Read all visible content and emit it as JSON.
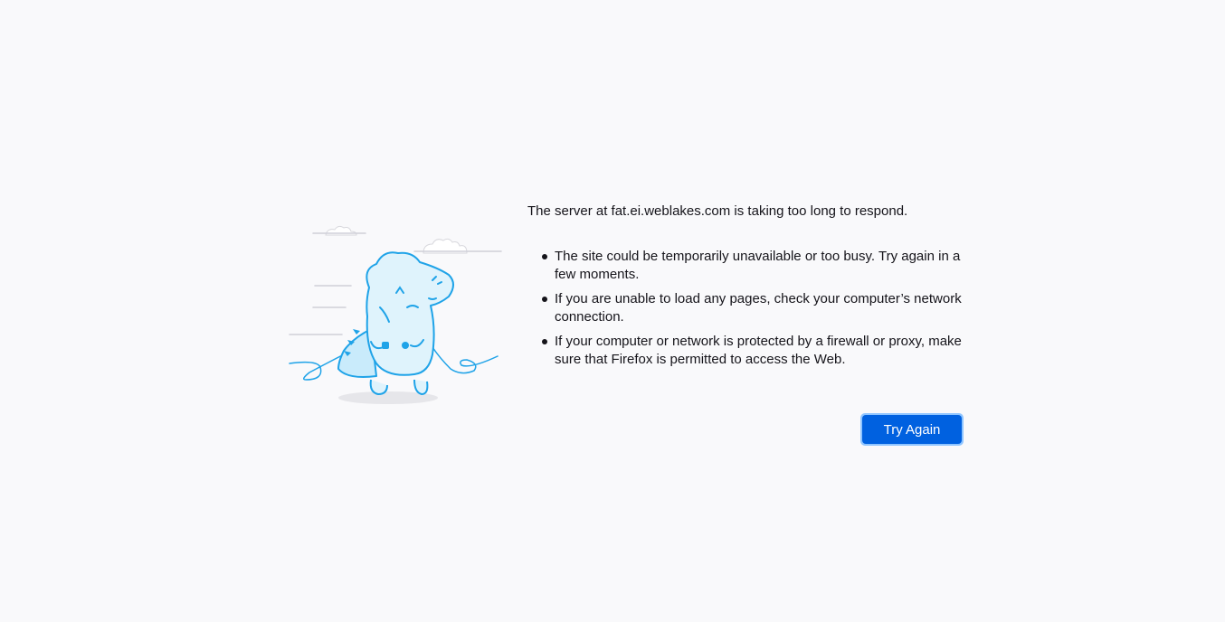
{
  "error": {
    "title": "The server at fat.ei.weblakes.com is taking too long to respond.",
    "reasons": [
      "The site could be temporarily unavailable or too busy. Try again in a few moments.",
      "If you are unable to load any pages, check your computer’s network connection.",
      "If your computer or network is protected by a firewall or proxy, make sure that Firefox is permitted to access the Web."
    ],
    "try_again_label": "Try Again"
  },
  "colors": {
    "background": "#f9f9fb",
    "accent": "#0061e0",
    "illustration_stroke": "#1fa3e8",
    "illustration_fill": "#dff3fc"
  },
  "illustration": {
    "icon": "unplugged-dino-icon"
  }
}
